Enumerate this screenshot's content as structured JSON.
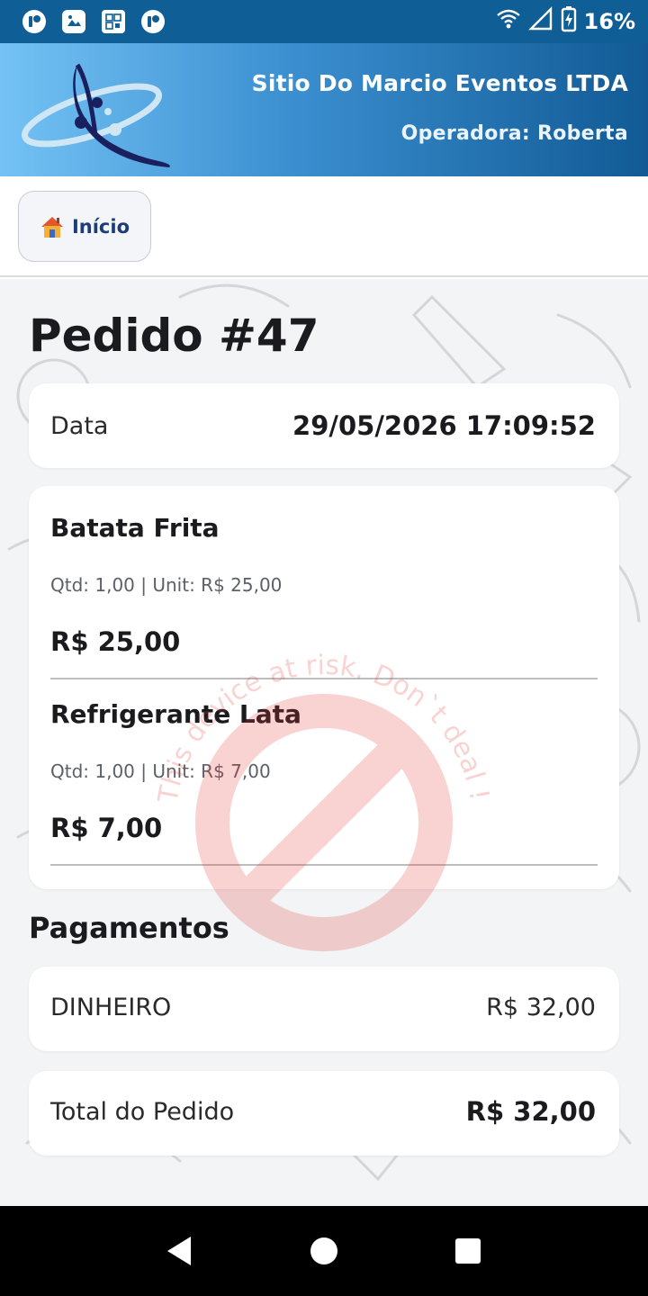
{
  "status_bar": {
    "battery_percent": "16%",
    "left_icons": [
      "app-p-icon",
      "image-icon",
      "qr-icon",
      "app-p-icon"
    ],
    "right_icons": [
      "wifi-icon",
      "signal-icon",
      "battery-charging-icon"
    ]
  },
  "header": {
    "company": "Sitio Do Marcio Eventos LTDA",
    "operator": "Operadora: Roberta"
  },
  "nav": {
    "home_label": "Início",
    "home_icon": "house-icon"
  },
  "order": {
    "title": "Pedido #47",
    "date_label": "Data",
    "date_value": "29/05/2026 17:09:52",
    "items": [
      {
        "name": "Batata Frita",
        "detail": "Qtd: 1,00 | Unit: R$ 25,00",
        "price": "R$ 25,00"
      },
      {
        "name": "Refrigerante Lata",
        "detail": "Qtd: 1,00 | Unit: R$ 7,00",
        "price": "R$ 7,00"
      }
    ]
  },
  "payments": {
    "title": "Pagamentos",
    "rows": [
      {
        "method": "DINHEIRO",
        "value": "R$ 32,00"
      }
    ]
  },
  "total": {
    "label": "Total do Pedido",
    "value": "R$ 32,00"
  },
  "watermark": {
    "text": "This device at risk. Don`t deal !",
    "color": "#e53935"
  },
  "colors": {
    "status_bar": "#0f5f96",
    "header_start": "#74c2f5",
    "header_end": "#115a95",
    "accent_text": "#1d3d7a"
  }
}
